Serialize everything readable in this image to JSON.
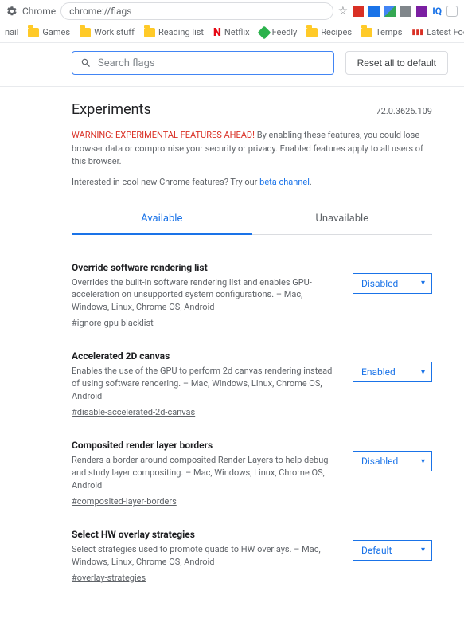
{
  "browser": {
    "tab_title": "Chrome",
    "url": "chrome://flags",
    "ext": {
      "iq_label": "IQ"
    }
  },
  "bookmarks": {
    "mail": "nail",
    "games": "Games",
    "work": "Work stuff",
    "reading": "Reading list",
    "netflix": "Netflix",
    "feedly": "Feedly",
    "recipes": "Recipes",
    "temps": "Temps",
    "football": "Latest Football New..."
  },
  "controls": {
    "search_placeholder": "Search flags",
    "reset_label": "Reset all to default"
  },
  "page": {
    "title": "Experiments",
    "version": "72.0.3626.109",
    "warning_bold": "WARNING: EXPERIMENTAL FEATURES AHEAD!",
    "warning_rest": " By enabling these features, you could lose browser data or compromise your security or privacy. Enabled features apply to all users of this browser.",
    "beta_prefix": "Interested in cool new Chrome features? Try our ",
    "beta_link": "beta channel",
    "beta_suffix": ".",
    "tab_available": "Available",
    "tab_unavailable": "Unavailable"
  },
  "flags": [
    {
      "title": "Override software rendering list",
      "desc": "Overrides the built-in software rendering list and enables GPU-acceleration on unsupported system configurations. – Mac, Windows, Linux, Chrome OS, Android",
      "anchor": "#ignore-gpu-blacklist",
      "value": "Disabled"
    },
    {
      "title": "Accelerated 2D canvas",
      "desc": "Enables the use of the GPU to perform 2d canvas rendering instead of using software rendering. – Mac, Windows, Linux, Chrome OS, Android",
      "anchor": "#disable-accelerated-2d-canvas",
      "value": "Enabled"
    },
    {
      "title": "Composited render layer borders",
      "desc": "Renders a border around composited Render Layers to help debug and study layer compositing. – Mac, Windows, Linux, Chrome OS, Android",
      "anchor": "#composited-layer-borders",
      "value": "Disabled"
    },
    {
      "title": "Select HW overlay strategies",
      "desc": "Select strategies used to promote quads to HW overlays. – Mac, Windows, Linux, Chrome OS, Android",
      "anchor": "#overlay-strategies",
      "value": "Default"
    }
  ]
}
